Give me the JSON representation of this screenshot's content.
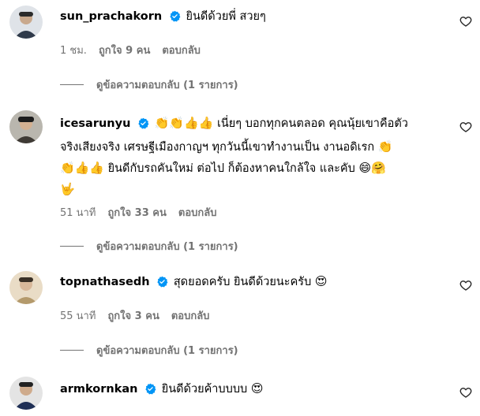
{
  "colors": {
    "verified": "#0095f6",
    "meta_text": "#737373",
    "primary_text": "#000000"
  },
  "icons": {
    "verified": "verified-badge-icon",
    "like": "heart-outline-icon"
  },
  "comments": [
    {
      "username": "sun_prachakorn",
      "verified": true,
      "text_lines": [
        "ยินดีด้วยพี่ สวยๆ"
      ],
      "time": "1 ชม.",
      "likes": "ถูกใจ 9 คน",
      "reply": "ตอบกลับ",
      "view_replies": "ดูข้อความตอบกลับ (1 รายการ)"
    },
    {
      "username": "icesarunyu",
      "verified": true,
      "emoji_prefix": "👏👏👍👍",
      "text_lines": [
        "เนี่ยๆ บอกทุกคนตลอด คุณนุ้ยเขาคือตัว",
        "จริงเสียงจริง เศรษฐีเมืองกาญฯ ทุกวันนี้เขาทำงานเป็น งานอดิเรก",
        "ยินดีกับรถคันใหม่ ต่อไป ก็ต้องหาคนใกล้ใจ และคับ"
      ],
      "emoji_line2_end": "👏",
      "emoji_line3_start": "👏👍👍",
      "emoji_line3_end": "😄🤗",
      "emoji_line4": "🤟",
      "time": "51 นาที",
      "likes": "ถูกใจ 33 คน",
      "reply": "ตอบกลับ",
      "view_replies": "ดูข้อความตอบกลับ (1 รายการ)"
    },
    {
      "username": "topnathasedh",
      "verified": true,
      "text_lines": [
        "สุดยอดครับ ยินดีด้วยนะครับ"
      ],
      "emoji_end": "😍",
      "time": "55 นาที",
      "likes": "ถูกใจ 3 คน",
      "reply": "ตอบกลับ",
      "view_replies": "ดูข้อความตอบกลับ (1 รายการ)"
    },
    {
      "username": "armkornkan",
      "verified": true,
      "text_lines": [
        "ยินดีด้วยค้าบบบบ"
      ],
      "emoji_end": "😍"
    }
  ]
}
